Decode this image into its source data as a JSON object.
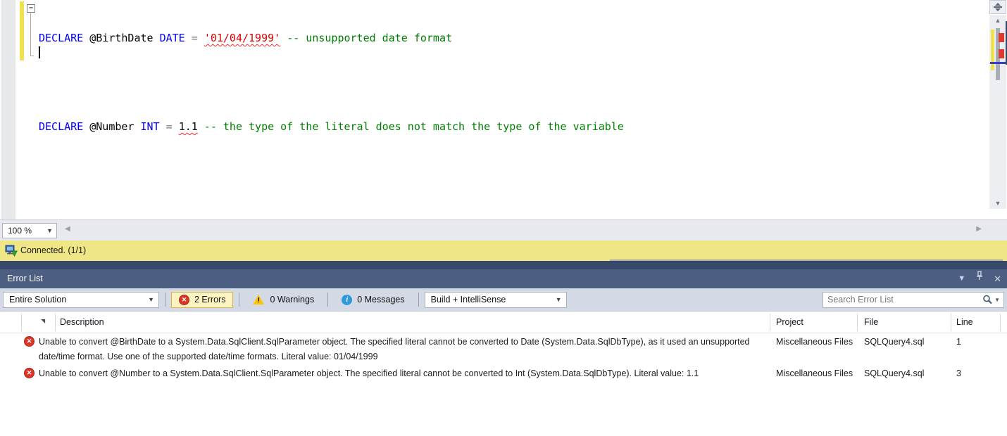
{
  "editor": {
    "fold_toggle": "−",
    "zoom_level": "100 %",
    "lines": [
      {
        "tokens": {
          "kw1": "DECLARE",
          "var": " @BirthDate ",
          "kw2": "DATE",
          "op": " = ",
          "lit": "'01/04/1999'",
          "comment": " -- unsupported date format"
        }
      },
      {
        "tokens": {
          "kw1": "DECLARE",
          "var": " @Number ",
          "kw2": "INT",
          "op": " = ",
          "lit": "1.1",
          "comment": " -- the type of the literal does not match the type of the variable"
        }
      }
    ]
  },
  "status_bar": {
    "text": "Connected. (1/1)"
  },
  "error_list": {
    "title": "Error List",
    "scope_filter": "Entire Solution",
    "errors_label": "2 Errors",
    "warnings_label": "0 Warnings",
    "messages_label": "0 Messages",
    "source_filter": "Build + IntelliSense",
    "search_placeholder": "Search Error List",
    "columns": {
      "description": "Description",
      "project": "Project",
      "file": "File",
      "line": "Line"
    },
    "rows": [
      {
        "description": "Unable to convert @BirthDate to a System.Data.SqlClient.SqlParameter object. The specified literal cannot be converted to Date (System.Data.SqlDbType), as it used an unsupported date/time format. Use one of the supported date/time formats. Literal value: 01/04/1999",
        "project": "Miscellaneous Files",
        "file": "SQLQuery4.sql",
        "line": "1"
      },
      {
        "description": "Unable to convert @Number to a System.Data.SqlClient.SqlParameter object. The specified literal cannot be converted to Int (System.Data.SqlDbType). Literal value: 1.1",
        "project": "Miscellaneous Files",
        "file": "SQLQuery4.sql",
        "line": "3"
      }
    ]
  },
  "colors": {
    "status_bar_bg": "#efe685",
    "dock_bg": "#36496b",
    "panel_titlebar_bg": "#4c5f82",
    "toolbar_bg": "#d4d9e6",
    "filter_active_bg": "#fcf3c0",
    "filter_active_border": "#d9b44a",
    "error_red": "#de3526",
    "warning_yellow": "#fcc40a",
    "info_blue": "#2e9bd8",
    "keyword_blue": "#0000ff",
    "comment_green": "#008000",
    "literal_red": "#e00000",
    "change_bar_yellow": "#f0e24f",
    "caret_mark_blue": "#3640c8"
  }
}
